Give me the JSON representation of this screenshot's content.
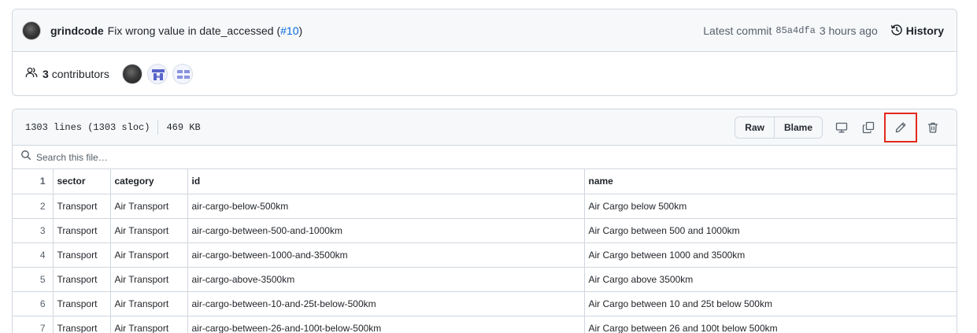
{
  "commit": {
    "author": "grindcode",
    "message": "Fix wrong value in date_accessed (",
    "pr_link": "#10",
    "message_end": ")",
    "latest_label": "Latest commit",
    "sha": "85a4dfa",
    "time": "3 hours ago",
    "history_label": "History"
  },
  "contributors": {
    "count": "3",
    "label": "contributors"
  },
  "file": {
    "lines_info": "1303 lines (1303 sloc)",
    "size": "469 KB",
    "actions": {
      "raw": "Raw",
      "blame": "Blame"
    },
    "icons": [
      "desktop-icon",
      "copy-icon",
      "pencil-icon",
      "trash-icon"
    ],
    "search_placeholder": "Search this file…"
  },
  "table": {
    "rows": [
      [
        "1",
        "sector",
        "category",
        "id",
        "name"
      ],
      [
        "2",
        "Transport",
        "Air Transport",
        "air-cargo-below-500km",
        "Air Cargo below 500km"
      ],
      [
        "3",
        "Transport",
        "Air Transport",
        "air-cargo-between-500-and-1000km",
        "Air Cargo between 500 and 1000km"
      ],
      [
        "4",
        "Transport",
        "Air Transport",
        "air-cargo-between-1000-and-3500km",
        "Air Cargo between 1000 and 3500km"
      ],
      [
        "5",
        "Transport",
        "Air Transport",
        "air-cargo-above-3500km",
        "Air Cargo above 3500km"
      ],
      [
        "6",
        "Transport",
        "Air Transport",
        "air-cargo-between-10-and-25t-below-500km",
        "Air Cargo between 10 and 25t below 500km"
      ],
      [
        "7",
        "Transport",
        "Air Transport",
        "air-cargo-between-26-and-100t-below-500km",
        "Air Cargo between 26 and 100t below 500km"
      ]
    ]
  },
  "colors": {
    "link": "#0969da",
    "highlight": "#e5291c",
    "border": "#d0d7de",
    "header_bg": "#f6f8fa"
  }
}
